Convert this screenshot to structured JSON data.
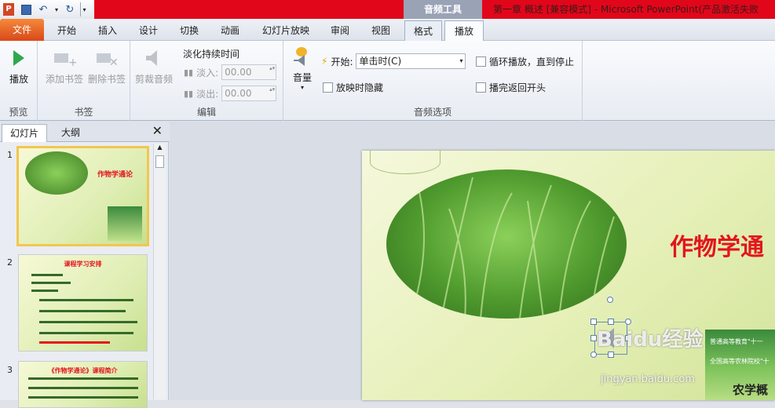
{
  "titlebar": {
    "contextual_tab_group": "音频工具",
    "window_title": "第一章    概述 [兼容模式] - Microsoft PowerPoint(产品激活失败"
  },
  "tabs": [
    "文件",
    "开始",
    "插入",
    "设计",
    "切换",
    "动画",
    "幻灯片放映",
    "审阅",
    "视图",
    "格式",
    "播放"
  ],
  "active_tab": "播放",
  "ribbon": {
    "preview": {
      "play_label": "播放",
      "group_label": "预览"
    },
    "bookmarks": {
      "add_label": "添加书签",
      "remove_label": "删除书签",
      "group_label": "书签"
    },
    "editing": {
      "trim_label": "剪裁音频",
      "fade_title": "淡化持续时间",
      "fade_in_label": "淡入:",
      "fade_in_value": "00.00",
      "fade_out_label": "淡出:",
      "fade_out_value": "00.00",
      "group_label": "编辑"
    },
    "audio_options": {
      "volume_label": "音量",
      "start_label": "开始:",
      "start_value": "单击时(C)",
      "hide_label": "放映时隐藏",
      "loop_label": "循环播放，直到停止",
      "rewind_label": "播完返回开头",
      "group_label": "音频选项"
    }
  },
  "left_pane": {
    "tab_slides": "幻灯片",
    "tab_outline": "大纲",
    "thumbnails": [
      {
        "num": "1",
        "title": "作物学通论"
      },
      {
        "num": "2",
        "title": "课程学习安排"
      },
      {
        "num": "3",
        "title": "《作物学通论》课程简介"
      }
    ]
  },
  "slide": {
    "title": "作物学通",
    "book_title": "农学概",
    "book_lines": [
      "普通高等教育\"十一",
      "全国高等农林院校\"十"
    ]
  },
  "watermark": {
    "text": "Baidu经验",
    "url": "jingyan.baidu.com"
  },
  "colors": {
    "title_bar_red": "#e2061a",
    "file_tab": "#e0602a",
    "slide_title": "#e3151c"
  }
}
